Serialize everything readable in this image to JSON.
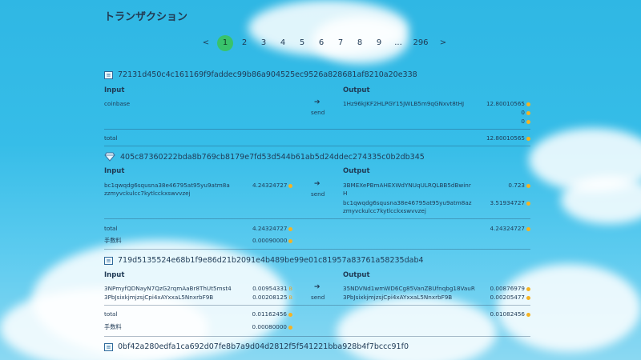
{
  "title": "トランザクション",
  "pagination": {
    "prev": "<",
    "pages": [
      "1",
      "2",
      "3",
      "4",
      "5",
      "6",
      "7",
      "8",
      "9",
      "...",
      "296"
    ],
    "next": ">",
    "active": "1"
  },
  "labels": {
    "input": "Input",
    "output": "Output",
    "total": "total",
    "fee": "手数料",
    "send": "send",
    "arrow": "➔"
  },
  "transactions": [
    {
      "hash": "72131d450c4c161169f9faddec99b86a904525ec9526a828681af8210a20e338",
      "icon": "doc-icon",
      "inputs": [
        {
          "address": "coinbase",
          "amount": ""
        }
      ],
      "outputs": [
        {
          "address": "1Hz96kJKF2HLPGY15JWLB5m9qGNxvt8tHJ",
          "amount": "12.80010565"
        },
        {
          "address": "",
          "amount": "0"
        },
        {
          "address": "",
          "amount": "0"
        }
      ],
      "total_in": "",
      "total_out": "12.80010565",
      "fee": ""
    },
    {
      "hash": "405c87360222bda8b769cb8179e7fd53d544b61ab5d24ddec274335c0b2db345",
      "icon": "diamond-icon",
      "inputs": [
        {
          "address": "bc1qwqdg6squsna38e46795at95yu9atm8azzmyvckulcc7kytlcckxswvvzej",
          "amount": "4.24324727"
        }
      ],
      "outputs": [
        {
          "address": "3BMEXePBmAHEXWdYNUqULRQLBB5dBwinrH",
          "amount": "0.723"
        },
        {
          "address": "bc1qwqdg6squsna38e46795at95yu9atm8azzmyvckulcc7kytlcckxswvvzej",
          "amount": "3.51934727"
        }
      ],
      "total_in": "4.24324727",
      "total_out": "4.24324727",
      "fee": "0.00090000"
    },
    {
      "hash": "719d5135524e68b1f9e86d21b2091e4b489be99e01c81957a83761a58235dab4",
      "icon": "doc-icon",
      "inputs": [
        {
          "address": "3NPmyfQDNayN7QzG2rqmAaBr8ThUt5mst4",
          "amount": "0.00954331"
        },
        {
          "address": "3PbJsixkjmjzsjCpi4xAYxxaL5NnxrbF9B",
          "amount": "0.00208125"
        }
      ],
      "outputs": [
        {
          "address": "35NDVNd1wmWD6Cg85VanZBUfnqbg18VauR",
          "amount": "0.00876979"
        },
        {
          "address": "3PbJsixkjmjzsjCpi4xAYxxaL5NnxrbF9B",
          "amount": "0.00205477"
        }
      ],
      "total_in": "0.01162456",
      "total_out": "0.01082456",
      "fee": "0.00080000"
    },
    {
      "hash": "0bf42a280edfa1ca692d07fe8b7a9d04d2812f5f541221bba928b4f7bccc91f0",
      "icon": "doc-icon"
    }
  ],
  "colors": {
    "sky": "#36bde8",
    "accent_page": "#39c36b",
    "coin": "#f5b323"
  }
}
